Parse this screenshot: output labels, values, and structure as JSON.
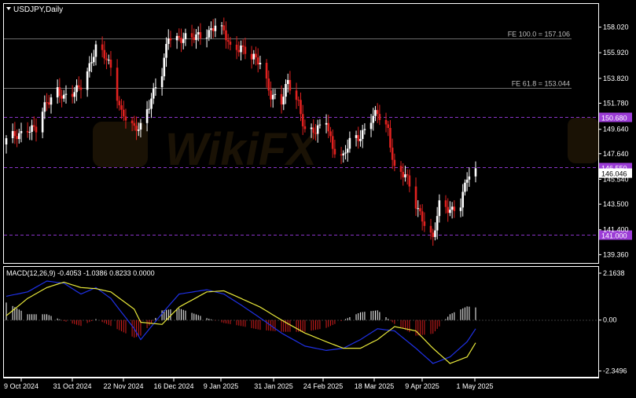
{
  "window": {
    "symbol_title": "USDJPY,Daily",
    "menu_icon": "triangle-down-icon"
  },
  "colors": {
    "background": "#000000",
    "frame": "#ffffff",
    "bull_candle": "#ffffff",
    "bear_candle": "#e0211f",
    "level_line": "#8a34c9",
    "fe_line": "#6c6c6c",
    "level_label_bg": "#9b3bd6",
    "macd_line": "#1f31e6",
    "signal_line": "#e8e83a",
    "hist_positive": "#ffffff",
    "hist_negative": "#d31d1d",
    "axis_text": "#ffffff"
  },
  "chart_data": [
    {
      "type": "candlestick",
      "title": "USDJPY,Daily",
      "ylim": [
        139.0,
        159.6
      ],
      "y_ticks": [
        "158.020",
        "155.920",
        "153.820",
        "151.780",
        "149.640",
        "147.640",
        "145.540",
        "143.500",
        "141.400",
        "139.360"
      ],
      "x_ticks": [
        "9 Oct 2024",
        "31 Oct 2024",
        "22 Nov 2024",
        "16 Dec 2024",
        "9 Jan 2025",
        "31 Jan 2025",
        "24 Feb 2025",
        "18 Mar 2025",
        "9 Apr 2025",
        "1 May 2025"
      ],
      "current_price": "146.046",
      "horizontal_levels": [
        {
          "label": "FE 100.0 = 157.106",
          "value": 157.106,
          "style": "fe"
        },
        {
          "label": "FE 61.8 = 153.044",
          "value": 153.044,
          "style": "fe"
        },
        {
          "label": "150.680",
          "value": 150.68,
          "style": "level"
        },
        {
          "label": "146.550",
          "value": 146.55,
          "style": "level"
        },
        {
          "label": "141.000",
          "value": 141.0,
          "style": "level"
        }
      ],
      "close_path": [
        {
          "date": "2024-10-04",
          "close": 148.7
        },
        {
          "date": "2024-10-09",
          "close": 149.2
        },
        {
          "date": "2024-10-14",
          "close": 149.8
        },
        {
          "date": "2024-10-18",
          "close": 149.5
        },
        {
          "date": "2024-10-23",
          "close": 151.9
        },
        {
          "date": "2024-10-28",
          "close": 153.0
        },
        {
          "date": "2024-10-31",
          "close": 152.1
        },
        {
          "date": "2024-11-04",
          "close": 152.4
        },
        {
          "date": "2024-11-08",
          "close": 153.4
        },
        {
          "date": "2024-11-12",
          "close": 154.9
        },
        {
          "date": "2024-11-15",
          "close": 156.2
        },
        {
          "date": "2024-11-20",
          "close": 155.4
        },
        {
          "date": "2024-11-22",
          "close": 154.8
        },
        {
          "date": "2024-11-27",
          "close": 151.0
        },
        {
          "date": "2024-12-03",
          "close": 149.5
        },
        {
          "date": "2024-12-06",
          "close": 150.0
        },
        {
          "date": "2024-12-11",
          "close": 152.3
        },
        {
          "date": "2024-12-16",
          "close": 154.1
        },
        {
          "date": "2024-12-19",
          "close": 157.3
        },
        {
          "date": "2024-12-24",
          "close": 157.2
        },
        {
          "date": "2024-12-30",
          "close": 157.0
        },
        {
          "date": "2025-01-06",
          "close": 157.6
        },
        {
          "date": "2025-01-10",
          "close": 158.2
        },
        {
          "date": "2025-01-14",
          "close": 157.5
        },
        {
          "date": "2025-01-17",
          "close": 156.3
        },
        {
          "date": "2025-01-22",
          "close": 156.5
        },
        {
          "date": "2025-01-27",
          "close": 155.4
        },
        {
          "date": "2025-01-31",
          "close": 155.1
        },
        {
          "date": "2025-02-05",
          "close": 152.6
        },
        {
          "date": "2025-02-10",
          "close": 151.8
        },
        {
          "date": "2025-02-13",
          "close": 153.4
        },
        {
          "date": "2025-02-18",
          "close": 151.9
        },
        {
          "date": "2025-02-21",
          "close": 149.6
        },
        {
          "date": "2025-02-26",
          "close": 149.3
        },
        {
          "date": "2025-03-03",
          "close": 150.5
        },
        {
          "date": "2025-03-06",
          "close": 148.2
        },
        {
          "date": "2025-03-11",
          "close": 147.2
        },
        {
          "date": "2025-03-14",
          "close": 148.6
        },
        {
          "date": "2025-03-19",
          "close": 149.2
        },
        {
          "date": "2025-03-24",
          "close": 150.5
        },
        {
          "date": "2025-03-27",
          "close": 150.8
        },
        {
          "date": "2025-04-01",
          "close": 149.6
        },
        {
          "date": "2025-04-04",
          "close": 146.5
        },
        {
          "date": "2025-04-09",
          "close": 145.8
        },
        {
          "date": "2025-04-14",
          "close": 143.4
        },
        {
          "date": "2025-04-17",
          "close": 142.5
        },
        {
          "date": "2025-04-22",
          "close": 140.6
        },
        {
          "date": "2025-04-25",
          "close": 143.3
        },
        {
          "date": "2025-04-30",
          "close": 143.1
        },
        {
          "date": "2025-05-05",
          "close": 143.6
        },
        {
          "date": "2025-05-08",
          "close": 145.6
        },
        {
          "date": "2025-05-12",
          "close": 146.0
        }
      ]
    },
    {
      "type": "line",
      "title": "MACD(12,26,9) -0.4053 -1.0386 0.8233 0.0000",
      "ylim": [
        -2.4,
        2.2
      ],
      "y_ticks": [
        "2.1638",
        "0.00",
        "-2.3496"
      ],
      "series": [
        {
          "name": "main",
          "style": "histogram",
          "points": [
            {
              "date": "2024-10-04",
              "value": 1.1
            },
            {
              "date": "2024-10-14",
              "value": 1.3
            },
            {
              "date": "2024-10-23",
              "value": 1.8
            },
            {
              "date": "2024-10-31",
              "value": 1.7
            },
            {
              "date": "2024-11-08",
              "value": 1.2
            },
            {
              "date": "2024-11-15",
              "value": 1.5
            },
            {
              "date": "2024-11-22",
              "value": 1.0
            },
            {
              "date": "2024-12-03",
              "value": -0.4
            },
            {
              "date": "2024-12-06",
              "value": -0.9
            },
            {
              "date": "2024-12-16",
              "value": 0.3
            },
            {
              "date": "2024-12-24",
              "value": 1.2
            },
            {
              "date": "2025-01-06",
              "value": 1.4
            },
            {
              "date": "2025-01-14",
              "value": 1.2
            },
            {
              "date": "2025-01-22",
              "value": 0.7
            },
            {
              "date": "2025-01-31",
              "value": 0.1
            },
            {
              "date": "2025-02-10",
              "value": -0.6
            },
            {
              "date": "2025-02-21",
              "value": -1.2
            },
            {
              "date": "2025-03-03",
              "value": -1.4
            },
            {
              "date": "2025-03-11",
              "value": -1.3
            },
            {
              "date": "2025-03-19",
              "value": -0.9
            },
            {
              "date": "2025-03-27",
              "value": -0.4
            },
            {
              "date": "2025-04-04",
              "value": -0.5
            },
            {
              "date": "2025-04-14",
              "value": -1.3
            },
            {
              "date": "2025-04-22",
              "value": -2.0
            },
            {
              "date": "2025-04-30",
              "value": -1.7
            },
            {
              "date": "2025-05-08",
              "value": -1.0
            },
            {
              "date": "2025-05-12",
              "value": -0.4
            }
          ]
        },
        {
          "name": "signal",
          "style": "line",
          "points": [
            {
              "date": "2024-10-04",
              "value": 0.2
            },
            {
              "date": "2024-10-14",
              "value": 1.0
            },
            {
              "date": "2024-10-23",
              "value": 1.5
            },
            {
              "date": "2024-10-31",
              "value": 1.75
            },
            {
              "date": "2024-11-08",
              "value": 1.5
            },
            {
              "date": "2024-11-15",
              "value": 1.45
            },
            {
              "date": "2024-11-22",
              "value": 1.3
            },
            {
              "date": "2024-12-03",
              "value": 0.5
            },
            {
              "date": "2024-12-06",
              "value": -0.1
            },
            {
              "date": "2024-12-16",
              "value": -0.2
            },
            {
              "date": "2024-12-24",
              "value": 0.6
            },
            {
              "date": "2025-01-06",
              "value": 1.3
            },
            {
              "date": "2025-01-14",
              "value": 1.35
            },
            {
              "date": "2025-01-22",
              "value": 1.0
            },
            {
              "date": "2025-01-31",
              "value": 0.6
            },
            {
              "date": "2025-02-10",
              "value": 0.0
            },
            {
              "date": "2025-02-21",
              "value": -0.6
            },
            {
              "date": "2025-03-03",
              "value": -1.0
            },
            {
              "date": "2025-03-11",
              "value": -1.3
            },
            {
              "date": "2025-03-19",
              "value": -1.3
            },
            {
              "date": "2025-03-27",
              "value": -0.9
            },
            {
              "date": "2025-04-04",
              "value": -0.3
            },
            {
              "date": "2025-04-14",
              "value": -0.5
            },
            {
              "date": "2025-04-22",
              "value": -1.3
            },
            {
              "date": "2025-04-30",
              "value": -2.0
            },
            {
              "date": "2025-05-08",
              "value": -1.7
            },
            {
              "date": "2025-05-12",
              "value": -1.05
            }
          ]
        }
      ]
    }
  ]
}
